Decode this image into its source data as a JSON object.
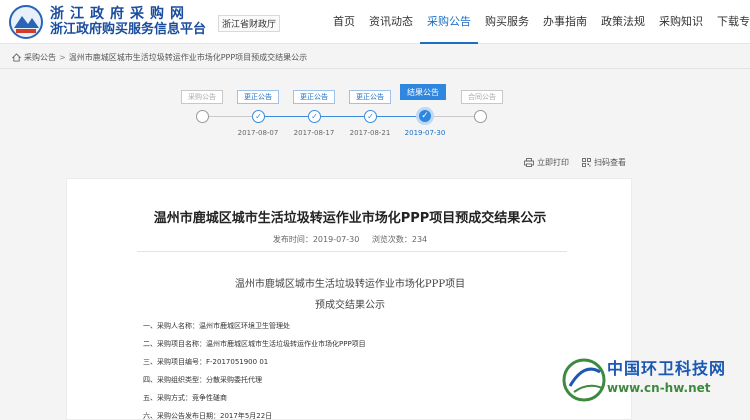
{
  "header": {
    "title_line1": "浙江政府采购网",
    "title_line2": "浙江政府购买服务信息平台",
    "department": "浙江省财政厅",
    "nav": [
      {
        "label": "首页",
        "active": false
      },
      {
        "label": "资讯动态",
        "active": false
      },
      {
        "label": "采购公告",
        "active": true
      },
      {
        "label": "购买服务",
        "active": false
      },
      {
        "label": "办事指南",
        "active": false
      },
      {
        "label": "政策法规",
        "active": false
      },
      {
        "label": "采购知识",
        "active": false
      },
      {
        "label": "下载专区",
        "active": false
      }
    ]
  },
  "breadcrumb": {
    "items": [
      "采购公告",
      "温州市鹿城区城市生活垃圾转运作业市场化PPP项目预成交结果公示"
    ],
    "separator": ">"
  },
  "timeline": {
    "steps": [
      {
        "label": "采购公告",
        "date": "",
        "state": "pending"
      },
      {
        "label": "更正公告",
        "date": "2017-08-07",
        "state": "done"
      },
      {
        "label": "更正公告",
        "date": "2017-08-17",
        "state": "done"
      },
      {
        "label": "更正公告",
        "date": "2017-08-21",
        "state": "done"
      },
      {
        "label": "结果公告",
        "date": "2019-07-30",
        "state": "current"
      },
      {
        "label": "合同公告",
        "date": "",
        "state": "pending"
      }
    ]
  },
  "tools": {
    "print": "立即打印",
    "scan": "扫码查看"
  },
  "article": {
    "title": "温州市鹿城区城市生活垃圾转运作业市场化PPP项目预成交结果公示",
    "publish_label": "发布时间：",
    "publish_date": "2019-07-30",
    "views_label": "浏览次数：",
    "views": "234",
    "doc_heading_1": "温州市鹿城区城市生活垃圾转运作业市场化PPP项目",
    "doc_heading_2": "预成交结果公示",
    "lines": [
      "一、采购人名称：温州市鹿城区环境卫生管理处",
      "二、采购项目名称：温州市鹿城区城市生活垃圾转运作业市场化PPP项目",
      "三、采购项目编号：F-2017051900 01",
      "四、采购组织类型：分散采购委托代理",
      "五、采购方式：竞争性磋商",
      "六、采购公告发布日期：2017年5月22日"
    ]
  },
  "watermark": {
    "name": "中国环卫科技网",
    "url": "www.cn-hw.net"
  },
  "colors": {
    "brand_blue": "#1a6fc4",
    "accent_blue": "#2f87e0",
    "watermark_green": "#3d8a3f"
  }
}
